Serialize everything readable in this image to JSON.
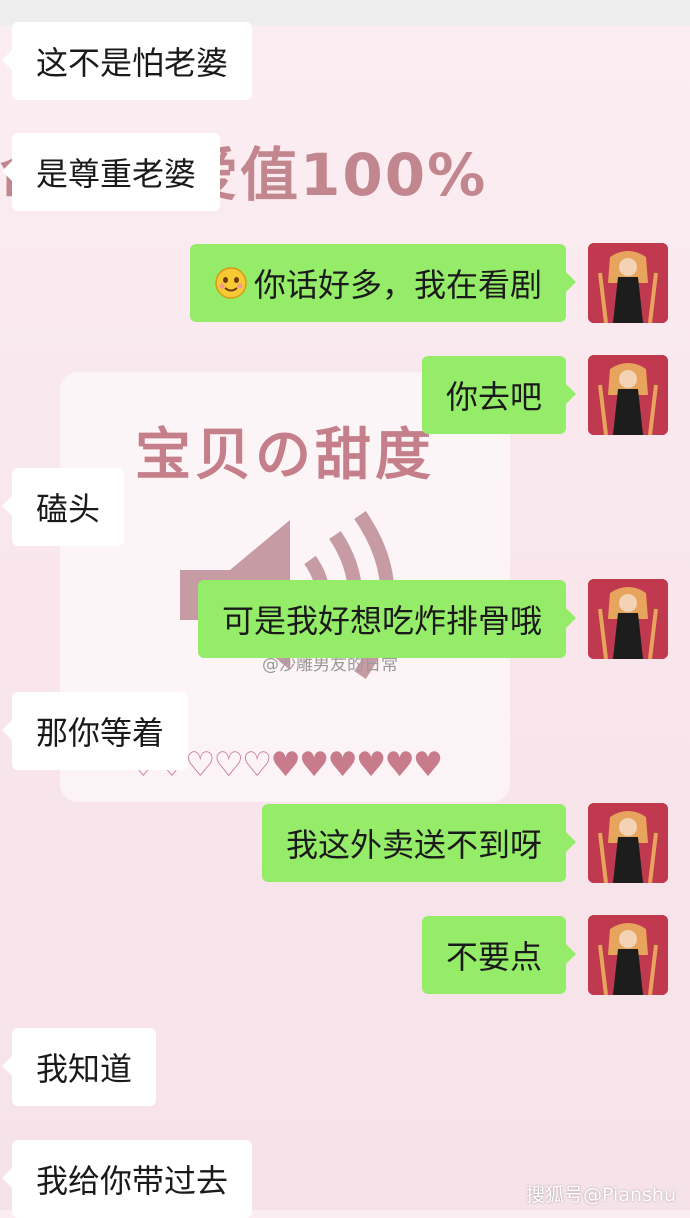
{
  "sticker": {
    "top_text": "命の可爱值100%",
    "title": "宝贝の甜度",
    "hearts": "♡♡♡♡♡♥♥♥♥♥♥"
  },
  "watermark": "@沙雕男友的日常",
  "corner_mark": "搜狐号@Pianshu",
  "messages": [
    {
      "side": "left",
      "text": "这不是怕老婆"
    },
    {
      "side": "left",
      "text": "是尊重老婆"
    },
    {
      "side": "right",
      "text": "你话好多，我在看剧",
      "emoji": "smiling-face"
    },
    {
      "side": "right",
      "text": "你去吧"
    },
    {
      "side": "left",
      "text": "磕头"
    },
    {
      "side": "right",
      "text": "可是我好想吃炸排骨哦"
    },
    {
      "side": "left",
      "text": "那你等着"
    },
    {
      "side": "right",
      "text": "我这外卖送不到呀"
    },
    {
      "side": "right",
      "text": "不要点"
    },
    {
      "side": "left",
      "text": "我知道"
    },
    {
      "side": "left",
      "text": "我给你带过去"
    }
  ],
  "colors": {
    "incoming_bubble": "#ffffff",
    "outgoing_bubble": "#95ec69",
    "background": "#f8e6ec",
    "sticker_accent": "#c57f8a"
  }
}
